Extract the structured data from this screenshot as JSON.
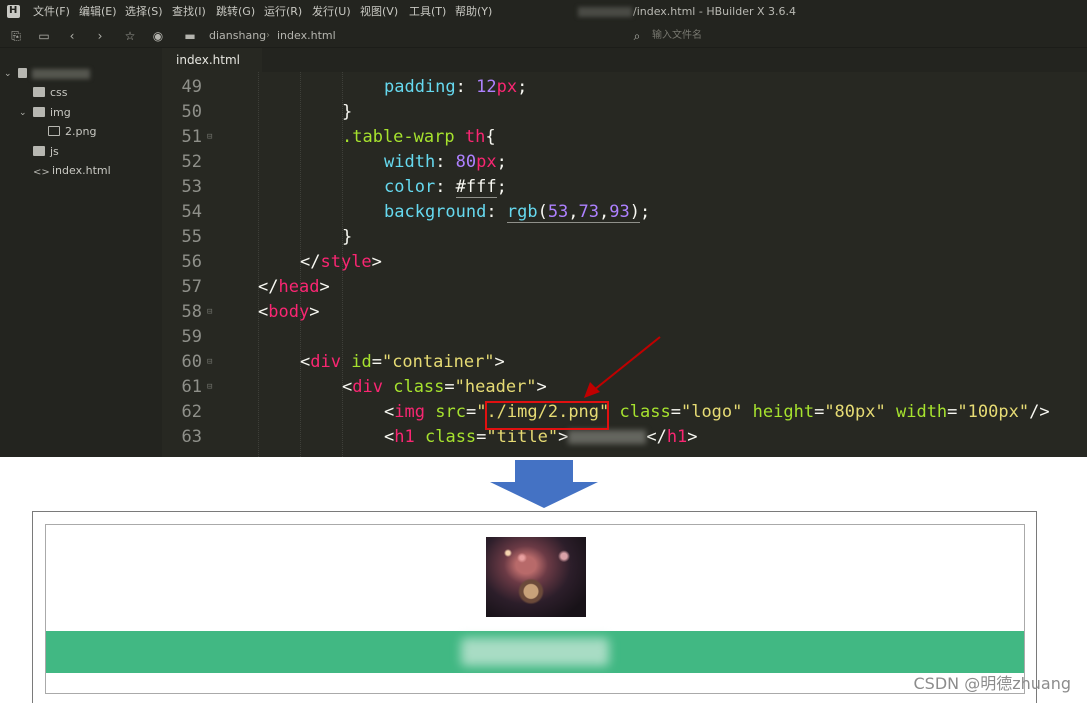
{
  "menubar": {
    "items": [
      "文件(F)",
      "编辑(E)",
      "选择(S)",
      "查找(I)",
      "跳转(G)",
      "运行(R)",
      "发行(U)",
      "视图(V)",
      "工具(T)",
      "帮助(Y)"
    ],
    "window_title": "/index.html - HBuilder X 3.6.4"
  },
  "toolbar": {
    "breadcrumb": [
      "dianshang",
      "index.html"
    ],
    "file_search_placeholder": "输入文件名"
  },
  "sidebar": {
    "items": [
      {
        "label": "css",
        "type": "folder"
      },
      {
        "label": "img",
        "type": "folder"
      },
      {
        "label": "2.png",
        "type": "image"
      },
      {
        "label": "js",
        "type": "folder"
      },
      {
        "label": "index.html",
        "type": "code"
      }
    ]
  },
  "tab": {
    "label": "index.html"
  },
  "code": {
    "line_numbers": [
      "49",
      "50",
      "51",
      "52",
      "53",
      "54",
      "55",
      "56",
      "57",
      "58",
      "59",
      "60",
      "61",
      "62",
      "63"
    ],
    "l49_prop": "padding",
    "l49_num": "12",
    "l49_unit": "px",
    "l50": "}",
    "l51_sel": ".table-warp",
    "l51_tag": "th",
    "l51_brace": "{",
    "l52_prop": "width",
    "l52_num": "80",
    "l52_unit": "px",
    "l53_prop": "color",
    "l53_val": "#fff",
    "l54_prop": "background",
    "l54_fn": "rgb",
    "l54_args": [
      "53",
      "73",
      "93"
    ],
    "l55": "}",
    "l56_tag": "style",
    "l57_tag": "head",
    "l58_tag": "body",
    "l60_tag": "div",
    "l60_attr": "id",
    "l60_val": "\"container\"",
    "l61_tag": "div",
    "l61_attr": "class",
    "l61_val": "\"header\"",
    "l62_tag": "img",
    "l62_attr1": "src",
    "l62_q": "\"",
    "l62_src": "./img/2.png",
    "l62_attr2": "class",
    "l62_val2": "\"logo\"",
    "l62_attr3": "height",
    "l62_val3": "\"80px\"",
    "l62_attr4": "width",
    "l62_val4": "\"100px\"",
    "l63_tag": "h1",
    "l63_attr": "class",
    "l63_val": "\"title\""
  },
  "annotation": {
    "box_color": "#e01010",
    "arrow_color": "#c00000"
  },
  "transition_arrow_color": "#4472c4",
  "preview": {
    "banner_color": "#41b883",
    "watermark": "CSDN @明德zhuang"
  }
}
